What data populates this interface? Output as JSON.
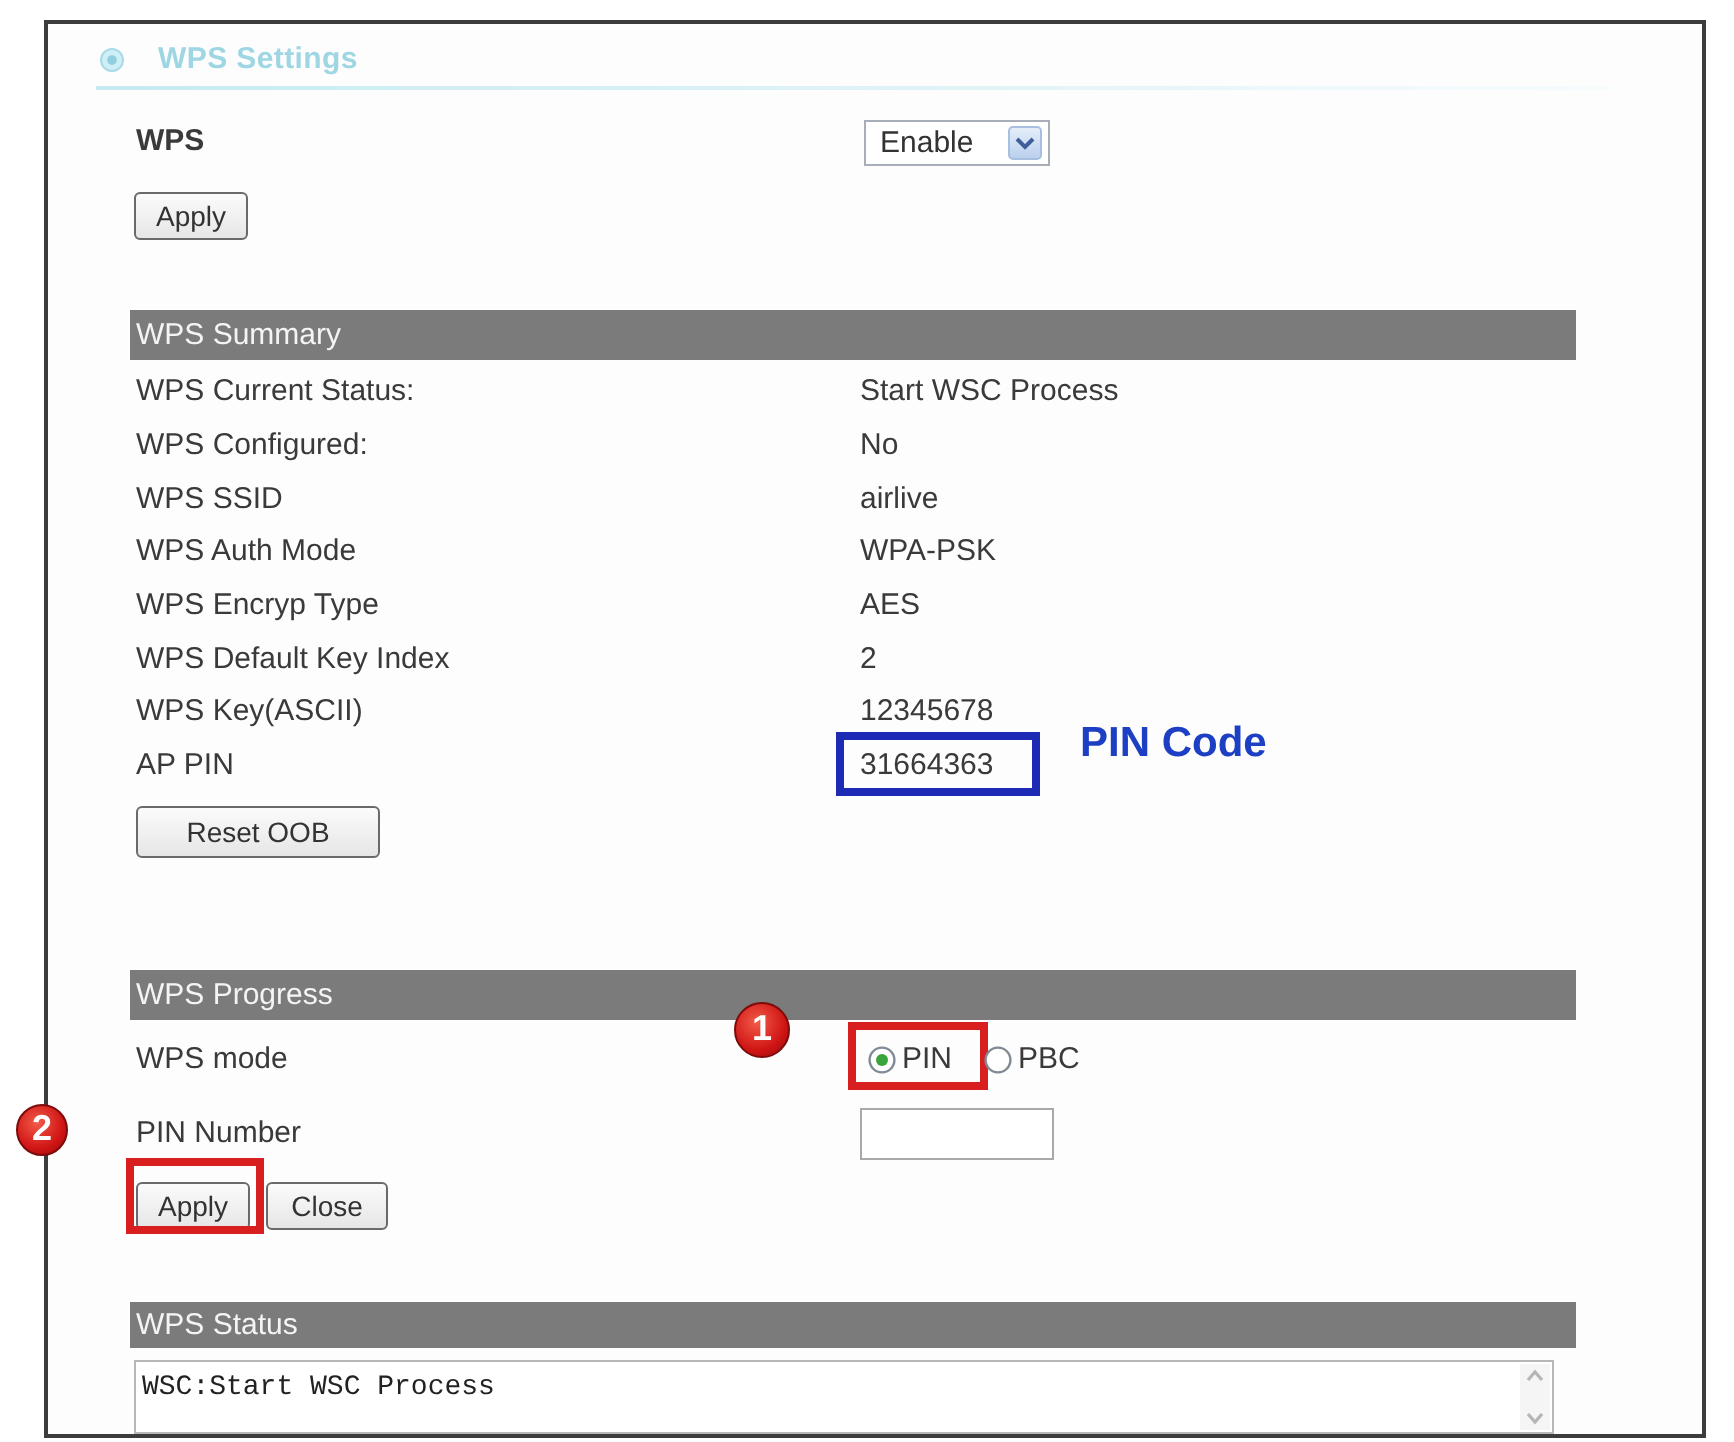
{
  "panel": {
    "title": "WPS Settings"
  },
  "wps": {
    "label": "WPS",
    "value": "Enable",
    "apply_button": "Apply"
  },
  "summary": {
    "header": "WPS Summary",
    "rows": [
      {
        "label": "WPS Current Status:",
        "value": "Start WSC Process",
        "highlighted": false
      },
      {
        "label": "WPS Configured:",
        "value": "No",
        "highlighted": false
      },
      {
        "label": "WPS SSID",
        "value": "airlive",
        "highlighted": false
      },
      {
        "label": "WPS Auth Mode",
        "value": "WPA-PSK",
        "highlighted": false
      },
      {
        "label": "WPS Encryp Type",
        "value": "AES",
        "highlighted": false
      },
      {
        "label": "WPS Default Key Index",
        "value": "2",
        "highlighted": false
      },
      {
        "label": "WPS Key(ASCII)",
        "value": "12345678",
        "highlighted": false
      },
      {
        "label": "AP PIN",
        "value": "31664363",
        "highlighted": true,
        "note": "PIN Code"
      }
    ],
    "reset_button": "Reset OOB"
  },
  "progress": {
    "header": "WPS Progress",
    "mode_label": "WPS mode",
    "modes": [
      {
        "label": "PIN",
        "selected": true,
        "highlighted": true,
        "step": "1"
      },
      {
        "label": "PBC",
        "selected": false,
        "highlighted": false
      }
    ],
    "pin_label": "PIN Number",
    "buttons": [
      {
        "label": "Apply",
        "highlighted": true,
        "step": "2"
      },
      {
        "label": "Close",
        "highlighted": false
      }
    ]
  },
  "status": {
    "header": "WPS Status",
    "text": "WSC:Start WSC Process"
  }
}
